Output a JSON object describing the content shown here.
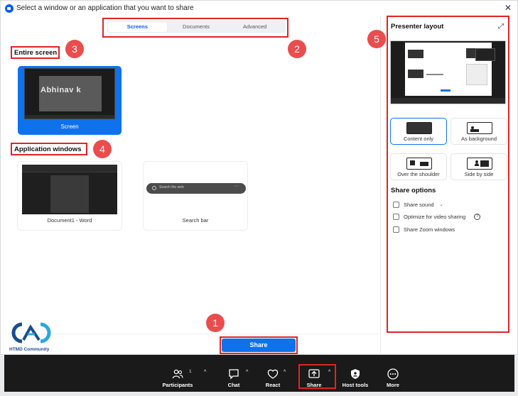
{
  "window": {
    "title": "Select a window or an application that you want to share"
  },
  "tabs": [
    {
      "label": "Screens",
      "active": true
    },
    {
      "label": "Documents",
      "active": false
    },
    {
      "label": "Advanced",
      "active": false
    }
  ],
  "sections": {
    "entire_screen": "Entire screen",
    "application_windows": "Application windows"
  },
  "screen_card": {
    "thumb_text": "Abhinav k",
    "name": "Screen"
  },
  "app_windows": [
    {
      "name": "Document1 - Word"
    },
    {
      "name": "Search bar",
      "thumb_text": "Search the web"
    }
  ],
  "share_button": "Share",
  "logo_text": "HTMD Community",
  "badges": [
    "1",
    "2",
    "3",
    "4",
    "5"
  ],
  "presenter": {
    "title": "Presenter layout",
    "layouts": [
      {
        "label": "Content only",
        "selected": true
      },
      {
        "label": "As background",
        "selected": false
      },
      {
        "label": "Over the shoulder",
        "selected": false
      },
      {
        "label": "Side by side",
        "selected": false
      }
    ],
    "share_options_title": "Share options",
    "options": [
      {
        "label": "Share sound",
        "checked": false
      },
      {
        "label": "Optimize for video sharing",
        "checked": false
      },
      {
        "label": "Share Zoom windows",
        "checked": false
      }
    ]
  },
  "toolbar": {
    "participants_label": "Participants",
    "participants_count": "1",
    "chat_label": "Chat",
    "react_label": "React",
    "share_label": "Share",
    "host_tools_label": "Host tools",
    "more_label": "More"
  },
  "colors": {
    "accent": "#0e72ed",
    "annotation": "#e02424",
    "badge": "#ea4d4d",
    "toolbar_bg": "#1a1a1a"
  }
}
